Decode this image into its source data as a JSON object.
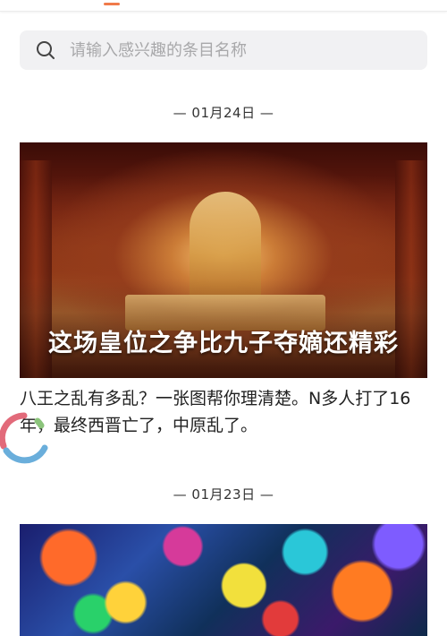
{
  "search": {
    "placeholder": "请输入感兴趣的条目名称",
    "icon": "search-icon"
  },
  "feed": [
    {
      "date": "— 01月24日 —",
      "image_title": "这场皇位之争比九子夺嫡还精彩",
      "summary": "八王之乱有多乱？一张图帮你理清楚。N多人打了16年，最终西晋亡了，中原乱了。"
    },
    {
      "date": "— 01月23日 —"
    }
  ],
  "colors": {
    "tab_indicator": "#f07a4a",
    "search_bg": "#f1f1f3",
    "spinner_red": "#e26a7a",
    "spinner_blue": "#6aaedb",
    "spinner_green": "#8bc47b"
  }
}
